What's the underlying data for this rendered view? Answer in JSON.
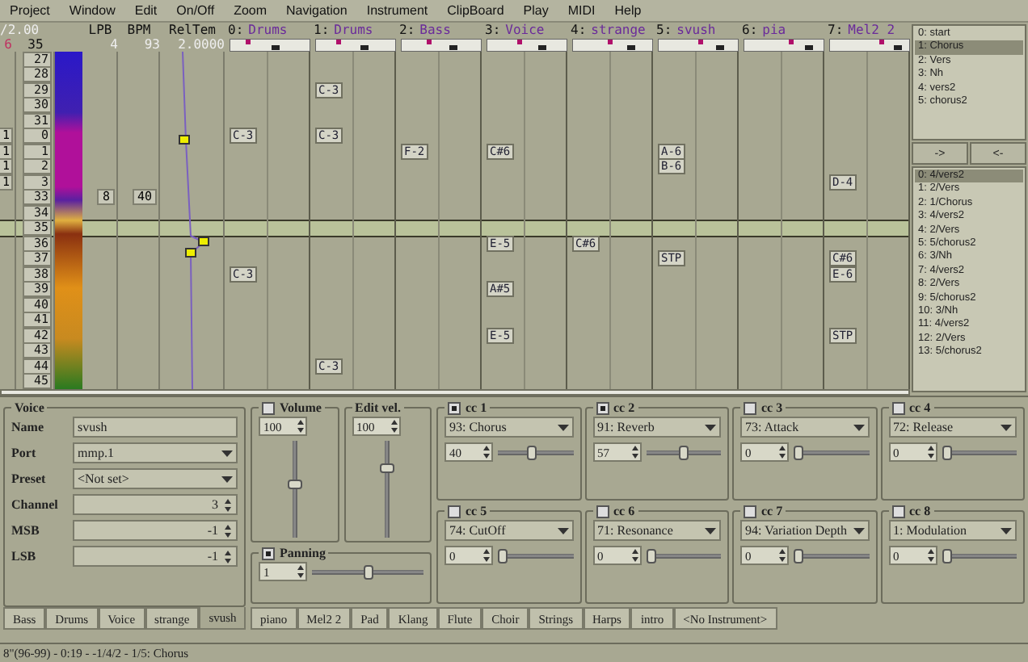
{
  "menu": [
    "Project",
    "Window",
    "Edit",
    "On/Off",
    "Zoom",
    "Navigation",
    "Instrument",
    "ClipBoard",
    "Play",
    "MIDI",
    "Help"
  ],
  "header": {
    "zoom": "/2.00",
    "marker": "6",
    "current_line": "35",
    "tempo_columns": [
      {
        "label": "LPB",
        "value": "4"
      },
      {
        "label": "BPM",
        "value": "93"
      },
      {
        "label": "RelTem",
        "value": "2.0000"
      }
    ],
    "tracks": [
      {
        "number": "0:",
        "name": "Drums"
      },
      {
        "number": "1:",
        "name": "Drums"
      },
      {
        "number": "2:",
        "name": "Bass"
      },
      {
        "number": "3:",
        "name": "Voice"
      },
      {
        "number": "4:",
        "name": "strange"
      },
      {
        "number": "5:",
        "name": "svush"
      },
      {
        "number": "6:",
        "name": "pia"
      },
      {
        "number": "7:",
        "name": "Mel2 2"
      }
    ]
  },
  "rows": [
    {
      "line": "27",
      "current": false
    },
    {
      "line": "28",
      "current": false
    },
    {
      "line": "29",
      "current": false,
      "notes": {
        "1": "C-3"
      }
    },
    {
      "line": "30",
      "current": false
    },
    {
      "line": "31",
      "current": false
    },
    {
      "line": "0",
      "block": "1",
      "current": false,
      "notes": {
        "0": "C-3",
        "1": "C-3"
      }
    },
    {
      "line": "1",
      "block": "1",
      "current": false,
      "notes": {
        "2": "F-2",
        "3": "C#6",
        "5": "A-6"
      }
    },
    {
      "line": "2",
      "block": "1",
      "current": false,
      "notes": {
        "5": "B-6"
      }
    },
    {
      "line": "3",
      "block": "1",
      "current": false,
      "notes": {
        "7": "D-4"
      }
    },
    {
      "line": "33",
      "current": false,
      "lpb": "8",
      "bpm": "40"
    },
    {
      "line": "34",
      "current": false
    },
    {
      "line": "35",
      "current": true
    },
    {
      "line": "36",
      "current": false,
      "notes": {
        "3": "E-5",
        "4": "C#6"
      }
    },
    {
      "line": "37",
      "current": false,
      "notes": {
        "5": "STP",
        "7": "C#6"
      }
    },
    {
      "line": "38",
      "current": false,
      "notes": {
        "0": "C-3",
        "7": "E-6"
      }
    },
    {
      "line": "39",
      "current": false,
      "notes": {
        "3": "A#5"
      }
    },
    {
      "line": "40",
      "current": false
    },
    {
      "line": "41",
      "current": false
    },
    {
      "line": "42",
      "current": false,
      "notes": {
        "3": "E-5",
        "7": "STP"
      }
    },
    {
      "line": "43",
      "current": false
    },
    {
      "line": "44",
      "current": false,
      "notes": {
        "1": "C-3"
      }
    },
    {
      "line": "45",
      "current": false
    }
  ],
  "blocks": [
    {
      "label": "0: start",
      "selected": false
    },
    {
      "label": "1: Chorus",
      "selected": true
    },
    {
      "label": "2: Vers",
      "selected": false
    },
    {
      "label": "3: Nh",
      "selected": false
    },
    {
      "label": "4: vers2",
      "selected": false
    },
    {
      "label": "5: chorus2",
      "selected": false
    }
  ],
  "playlist_buttons": [
    "->",
    "<-"
  ],
  "playlist": [
    {
      "label": "0: 4/vers2",
      "selected": true
    },
    {
      "label": "1: 2/Vers",
      "selected": false
    },
    {
      "label": "2: 1/Chorus",
      "selected": false
    },
    {
      "label": "3: 4/vers2",
      "selected": false
    },
    {
      "label": "4: 2/Vers",
      "selected": false
    },
    {
      "label": "5: 5/chorus2",
      "selected": false
    },
    {
      "label": "6: 3/Nh",
      "selected": false
    },
    {
      "label": "7: 4/vers2",
      "selected": false
    },
    {
      "label": "8: 2/Vers",
      "selected": false
    },
    {
      "label": "9: 5/chorus2",
      "selected": false
    },
    {
      "label": "10: 3/Nh",
      "selected": false
    },
    {
      "label": "11: 4/vers2",
      "selected": false
    },
    {
      "label": "12: 2/Vers",
      "selected": false
    },
    {
      "label": "13: 5/chorus2",
      "selected": false
    }
  ],
  "voice": {
    "title": "Voice",
    "fields": [
      {
        "label": "Name",
        "value": "svush",
        "kind": "text"
      },
      {
        "label": "Port",
        "value": "mmp.1",
        "kind": "select"
      },
      {
        "label": "Preset",
        "value": "<Not set>",
        "kind": "select"
      },
      {
        "label": "Channel",
        "value": "3",
        "kind": "spin"
      },
      {
        "label": "MSB",
        "value": "-1",
        "kind": "spin"
      },
      {
        "label": "LSB",
        "value": "-1",
        "kind": "spin"
      }
    ]
  },
  "voice_tabs": [
    {
      "label": "Bass",
      "selected": false
    },
    {
      "label": "Drums",
      "selected": false
    },
    {
      "label": "Voice",
      "selected": false
    },
    {
      "label": "strange",
      "selected": false
    },
    {
      "label": "svush",
      "selected": true
    }
  ],
  "volume": {
    "label": "Volume",
    "checked": false,
    "value": "100",
    "level": 0.55
  },
  "edit_velocity": {
    "label": "Edit vel.",
    "value": "100",
    "level": 0.75
  },
  "panning": {
    "label": "Panning",
    "checked": true,
    "value": "1",
    "level": 0.5
  },
  "ccs": [
    {
      "label": "cc 1",
      "checked": true,
      "controller": "93: Chorus",
      "value": "40",
      "level": 0.45
    },
    {
      "label": "cc 2",
      "checked": true,
      "controller": "91: Reverb",
      "value": "57",
      "level": 0.5
    },
    {
      "label": "cc 3",
      "checked": false,
      "controller": "73: Attack",
      "value": "0",
      "level": 0
    },
    {
      "label": "cc 4",
      "checked": false,
      "controller": "72: Release",
      "value": "0",
      "level": 0
    },
    {
      "label": "cc 5",
      "checked": false,
      "controller": "74: CutOff",
      "value": "0",
      "level": 0
    },
    {
      "label": "cc 6",
      "checked": false,
      "controller": "71: Resonance",
      "value": "0",
      "level": 0
    },
    {
      "label": "cc 7",
      "checked": false,
      "controller": "94: Variation Depth",
      "value": "0",
      "level": 0
    },
    {
      "label": "cc 8",
      "checked": false,
      "controller": "1: Modulation",
      "value": "0",
      "level": 0
    }
  ],
  "instrument_tabs": [
    {
      "label": "piano",
      "selected": false
    },
    {
      "label": "Mel2 2",
      "selected": false
    },
    {
      "label": "Pad",
      "selected": false
    },
    {
      "label": "Klang",
      "selected": false
    },
    {
      "label": "Flute",
      "selected": false
    },
    {
      "label": "Choir",
      "selected": false
    },
    {
      "label": "Strings",
      "selected": false
    },
    {
      "label": "Harps",
      "selected": false
    },
    {
      "label": "intro",
      "selected": false
    },
    {
      "label": "<No Instrument>",
      "selected": false
    }
  ],
  "status_bar": "8\"(96-99) - 0:19 - -1/4/2 - 1/5: Chorus"
}
